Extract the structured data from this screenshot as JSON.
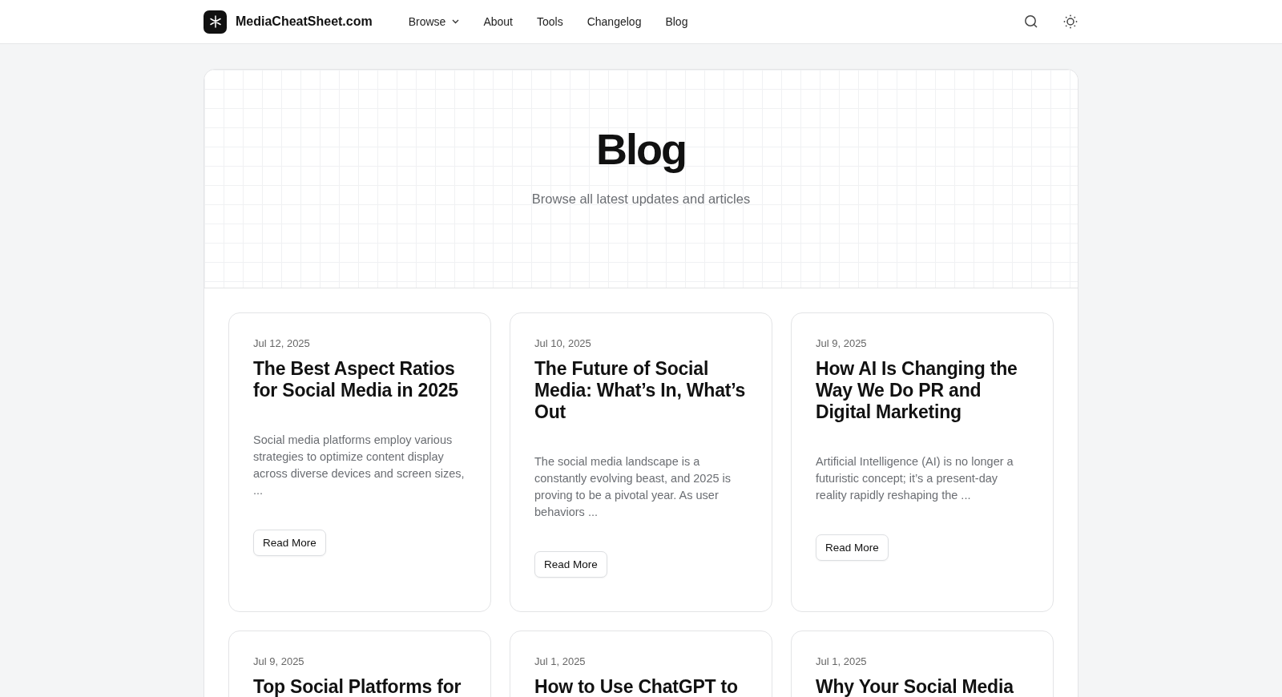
{
  "header": {
    "site_name": "MediaCheatSheet.com",
    "nav": [
      {
        "label": "Browse",
        "kind": "dropdown"
      },
      {
        "label": "About",
        "kind": "link"
      },
      {
        "label": "Tools",
        "kind": "link"
      },
      {
        "label": "Changelog",
        "kind": "link"
      },
      {
        "label": "Blog",
        "kind": "link"
      }
    ]
  },
  "hero": {
    "title": "Blog",
    "subtitle": "Browse all latest updates and articles"
  },
  "posts": [
    {
      "date": "Jul 12, 2025",
      "title": "The Best Aspect Ratios for Social Media in 2025",
      "excerpt": "Social media platforms employ various strategies to optimize content display across diverse devices and screen sizes, ...",
      "button": "Read More"
    },
    {
      "date": "Jul 10, 2025",
      "title": "The Future of Social Media: What’s In, What’s Out",
      "excerpt": "The social media landscape is a constantly evolving beast, and 2025 is proving to be a pivotal year. As user behaviors ...",
      "button": "Read More"
    },
    {
      "date": "Jul 9, 2025",
      "title": "How AI Is Changing the Way We Do PR and Digital Marketing",
      "excerpt": "Artificial Intelligence (AI) is no longer a futuristic concept; it’s a present-day reality rapidly reshaping the ...",
      "button": "Read More"
    },
    {
      "date": "Jul 9, 2025",
      "title": "Top Social Platforms for"
    },
    {
      "date": "Jul 1, 2025",
      "title": "How to Use ChatGPT to"
    },
    {
      "date": "Jul 1, 2025",
      "title": "Why Your Social Media"
    }
  ]
}
